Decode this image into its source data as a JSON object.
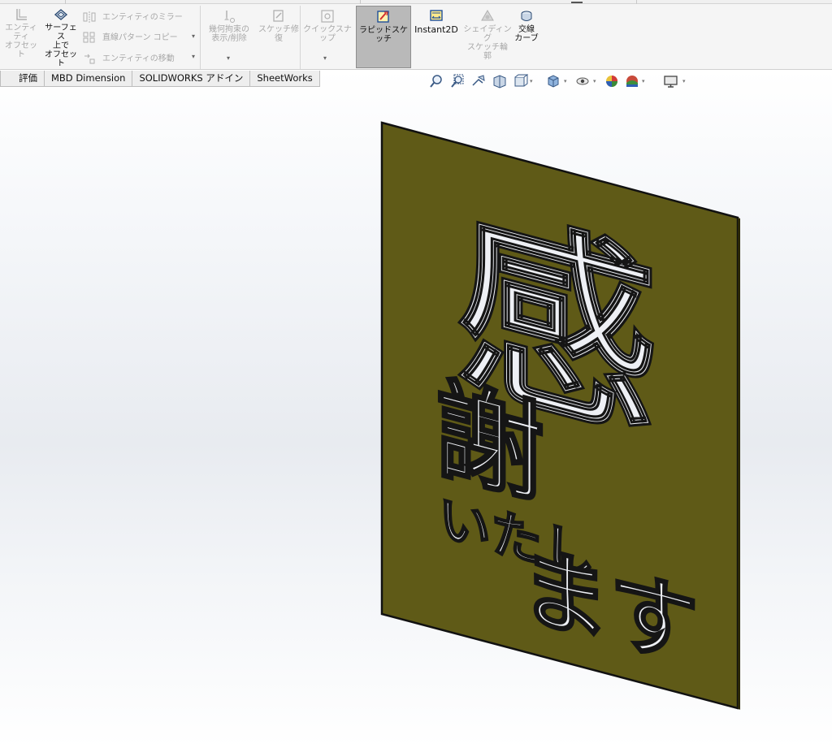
{
  "ribbon": {
    "offset_entities": {
      "line1": "エンティティ",
      "line2": "オフセット"
    },
    "offset_on_surface": {
      "line1": "サーフェス",
      "line2": "上で",
      "line3": "オフセット"
    },
    "mirror_entities": "エンティティのミラー",
    "linear_pattern": "直線パターン コピー",
    "move_entities": "エンティティの移動",
    "display_delete_relations": {
      "line1": "幾何拘束の",
      "line2": "表示/削除"
    },
    "repair_sketch": {
      "line1": "スケッチ修",
      "line2": "復"
    },
    "quick_snaps": "クイックスナップ",
    "rapid_sketch": "ラピッドスケッチ",
    "instant2d": "Instant2D",
    "shaded_sketch_contours": {
      "line1": "シェイディング",
      "line2": "スケッチ輪",
      "line3": "郭"
    },
    "intersection_curve": {
      "line1": "交線",
      "line2": "カーブ"
    }
  },
  "tabs": [
    "評価",
    "MBD Dimension",
    "SOLIDWORKS アドイン",
    "SheetWorks"
  ],
  "hud_icons": [
    "zoom-to-fit-icon",
    "zoom-to-area-icon",
    "previous-view-icon",
    "section-view-icon",
    "view-orientation-icon",
    "display-style-icon",
    "hide-show-items-icon",
    "edit-appearance-icon",
    "apply-scene-icon",
    "view-settings-icon"
  ],
  "model": {
    "plate_color": "#5f5a17",
    "cutout_text": [
      "感",
      "謝",
      "いたし",
      "ます"
    ]
  },
  "colors": {
    "ribbon_bg": "#f5f5f5",
    "selected_button": "#b9b9b9",
    "disabled_text": "#a8a8a8"
  }
}
